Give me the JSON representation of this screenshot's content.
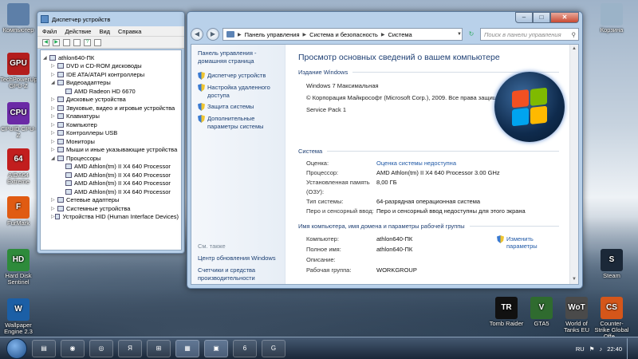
{
  "desktop": {
    "left_icons": [
      {
        "label": "Компьютер",
        "badge": "",
        "color": "#5d7fa8"
      },
      {
        "label": "TechPowerUp GPU-Z",
        "badge": "GPU",
        "color": "#b31d1d"
      },
      {
        "label": "CPUID CPU-Z",
        "badge": "CPU",
        "color": "#6b2aa6"
      },
      {
        "label": "AIDA64 Extreme",
        "badge": "64",
        "color": "#c21e1e"
      },
      {
        "label": "FurMark",
        "badge": "F",
        "color": "#e05b12"
      },
      {
        "label": "Hard Disk Sentinel",
        "badge": "HD",
        "color": "#2e8b3b"
      },
      {
        "label": "Wallpaper Engine 2.3",
        "badge": "W",
        "color": "#1b5fa6"
      }
    ],
    "right_icons": [
      {
        "label": "Корзина",
        "badge": "",
        "color": "#9bb3c8"
      },
      {
        "label": "Steam",
        "badge": "S",
        "color": "#1b2838"
      }
    ],
    "bottom_icons": [
      {
        "label": "Tomb Raider",
        "badge": "TR",
        "color": "#111111"
      },
      {
        "label": "GTA5",
        "badge": "V",
        "color": "#2f6b2f"
      },
      {
        "label": "World of Tanks EU",
        "badge": "WoT",
        "color": "#4a4a4a"
      },
      {
        "label": "Counter-Strike Global Offe...",
        "badge": "CS",
        "color": "#d4561a"
      }
    ]
  },
  "device_manager": {
    "title": "Диспетчер устройств",
    "menu": [
      "Файл",
      "Действие",
      "Вид",
      "Справка"
    ],
    "tree": [
      {
        "label": "athlon640-ПК",
        "level": 0,
        "expanded": true
      },
      {
        "label": "DVD и CD-ROM дисководы",
        "level": 1
      },
      {
        "label": "IDE ATA/ATAPI контроллеры",
        "level": 1
      },
      {
        "label": "Видеоадаптеры",
        "level": 1,
        "expanded": true
      },
      {
        "label": "AMD Radeon HD 6670",
        "level": 2
      },
      {
        "label": "Дисковые устройства",
        "level": 1
      },
      {
        "label": "Звуковые, видео и игровые устройства",
        "level": 1
      },
      {
        "label": "Клавиатуры",
        "level": 1
      },
      {
        "label": "Компьютер",
        "level": 1
      },
      {
        "label": "Контроллеры USB",
        "level": 1
      },
      {
        "label": "Мониторы",
        "level": 1
      },
      {
        "label": "Мыши и иные указывающие устройства",
        "level": 1
      },
      {
        "label": "Процессоры",
        "level": 1,
        "expanded": true
      },
      {
        "label": "AMD Athlon(tm) II X4 640 Processor",
        "level": 2
      },
      {
        "label": "AMD Athlon(tm) II X4 640 Processor",
        "level": 2
      },
      {
        "label": "AMD Athlon(tm) II X4 640 Processor",
        "level": 2
      },
      {
        "label": "AMD Athlon(tm) II X4 640 Processor",
        "level": 2
      },
      {
        "label": "Сетевые адаптеры",
        "level": 1
      },
      {
        "label": "Системные устройства",
        "level": 1
      },
      {
        "label": "Устройства HID (Human Interface Devices)",
        "level": 1
      }
    ]
  },
  "control_panel": {
    "breadcrumb": [
      "Панель управления",
      "Система и безопасность",
      "Система"
    ],
    "search_placeholder": "Поиск в панели управления",
    "left": {
      "home": "Панель управления - домашняя страница",
      "links": [
        "Диспетчер устройств",
        "Настройка удаленного доступа",
        "Защита системы",
        "Дополнительные параметры системы"
      ],
      "see_also_header": "См. также",
      "see_also": [
        "Центр обновления Windows",
        "Счетчики и средства производительности"
      ]
    },
    "page_title": "Просмотр основных сведений о вашем компьютере",
    "edition": {
      "header": "Издание Windows",
      "lines": [
        "Windows 7 Максимальная",
        "© Корпорация Майкрософт (Microsoft Corp.), 2009. Все права защищены.",
        "Service Pack 1"
      ]
    },
    "system": {
      "header": "Система",
      "rows": [
        {
          "k": "Оценка:",
          "v": "Оценка системы недоступна",
          "link": true
        },
        {
          "k": "Процессор:",
          "v": "AMD Athlon(tm) II X4 640 Processor   3.00 GHz"
        },
        {
          "k": "Установленная память (ОЗУ):",
          "v": "8,00 ГБ"
        },
        {
          "k": "Тип системы:",
          "v": "64-разрядная операционная система"
        },
        {
          "k": "Перо и сенсорный ввод:",
          "v": "Перо и сенсорный ввод недоступны для этого экрана"
        }
      ]
    },
    "computer": {
      "header": "Имя компьютера, имя домена и параметры рабочей группы",
      "change_label": "Изменить параметры",
      "rows": [
        {
          "k": "Компьютер:",
          "v": "athlon640-ПК"
        },
        {
          "k": "Полное имя:",
          "v": "athlon640-ПК"
        },
        {
          "k": "Описание:",
          "v": ""
        },
        {
          "k": "Рабочая группа:",
          "v": "WORKGROUP"
        }
      ]
    }
  },
  "taskbar": {
    "language": "RU",
    "time": "22:40",
    "apps": [
      "explorer",
      "chrome",
      "opera",
      "yandex",
      "windows",
      "control-panel",
      "device-manager",
      "aida",
      "gpuz"
    ]
  }
}
